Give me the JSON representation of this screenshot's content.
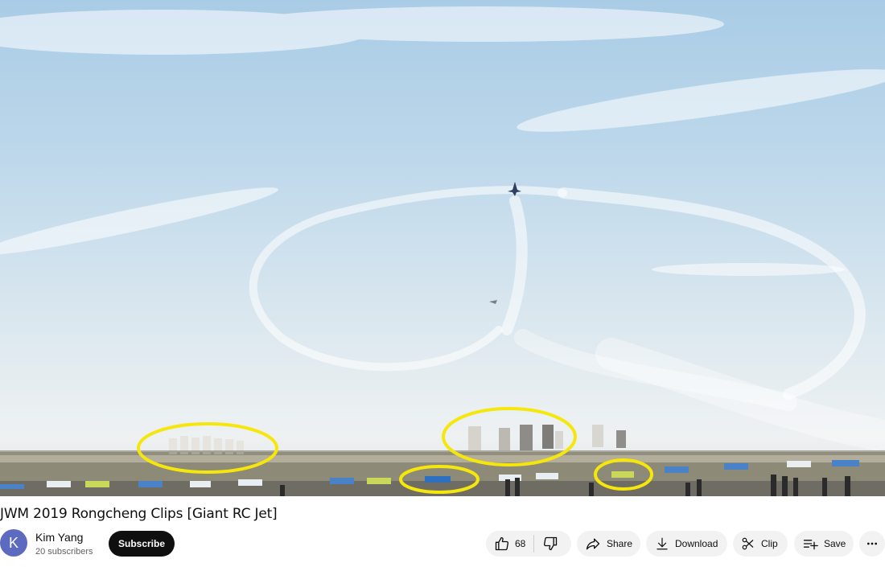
{
  "video": {
    "title": "JWM 2019 Rongcheng Clips [Giant RC Jet]"
  },
  "channel": {
    "avatar_letter": "K",
    "name": "Kim Yang",
    "subscribers": "20 subscribers",
    "subscribe_label": "Subscribe"
  },
  "actions": {
    "like_count": "68",
    "share_label": "Share",
    "download_label": "Download",
    "clip_label": "Clip",
    "save_label": "Save"
  },
  "colors": {
    "highlight_ellipse": "#f5e60c",
    "subscribe_bg": "#0f0f0f",
    "pill_bg": "#f2f2f2",
    "avatar_bg": "#5c6bc0"
  },
  "icons": [
    "thumbs-up-icon",
    "thumbs-down-icon",
    "share-arrow-icon",
    "download-icon",
    "scissors-icon",
    "playlist-add-icon",
    "more-horizontal-icon"
  ]
}
